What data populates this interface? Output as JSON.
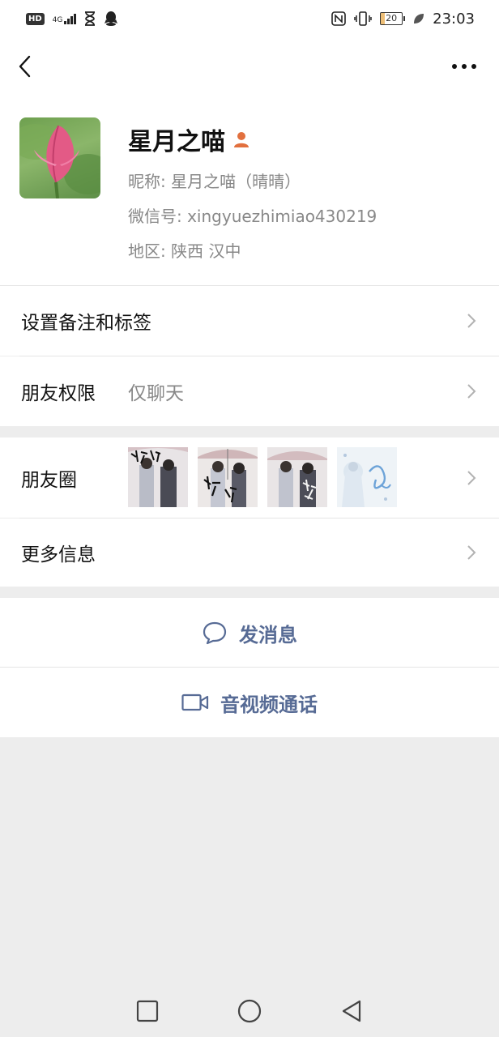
{
  "status_bar": {
    "hd": "HD",
    "network": "4G",
    "battery": "20",
    "time": "23:03"
  },
  "profile": {
    "name": "星月之喵",
    "nickname": "昵称: 星月之喵（晴晴）",
    "wechat_id": "微信号: xingyuezhimiao430219",
    "region": "地区: 陕西 汉中"
  },
  "cells": {
    "remark": "设置备注和标签",
    "permission_label": "朋友权限",
    "permission_value": "仅聊天",
    "moments": "朋友圈",
    "more_info": "更多信息"
  },
  "actions": {
    "message": "发消息",
    "video_call": "音视频通话"
  },
  "colors": {
    "link": "#576b95",
    "badge": "#e2703e",
    "background": "#ededed"
  }
}
